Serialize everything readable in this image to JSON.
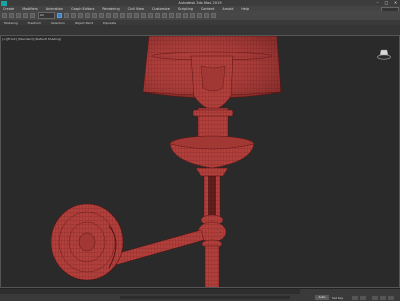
{
  "title_bar": {
    "title": "Autodesk 3ds Max 2019",
    "minimize": "–",
    "maximize": "□",
    "close": "✕"
  },
  "menu": {
    "items": [
      "Create",
      "Modifiers",
      "Animation",
      "Graph Editors",
      "Rendering",
      "Civil View",
      "Customize",
      "Scripting",
      "Content",
      "Arnold",
      "Help"
    ]
  },
  "toolbar": {
    "selection_set": "All"
  },
  "ribbon": {
    "tabs": [
      "Modeling",
      "Freeform",
      "Selection",
      "Object Paint",
      "Populate"
    ]
  },
  "viewport": {
    "label": "[+][Front] [Standard] [Default Shading]"
  },
  "statusbar": {
    "key_button": "Auto",
    "status_text": "Set Key"
  },
  "colors": {
    "model": "#b1403c",
    "wire": "#6a1a1a",
    "viewport_bg": "#2a2a2a"
  }
}
